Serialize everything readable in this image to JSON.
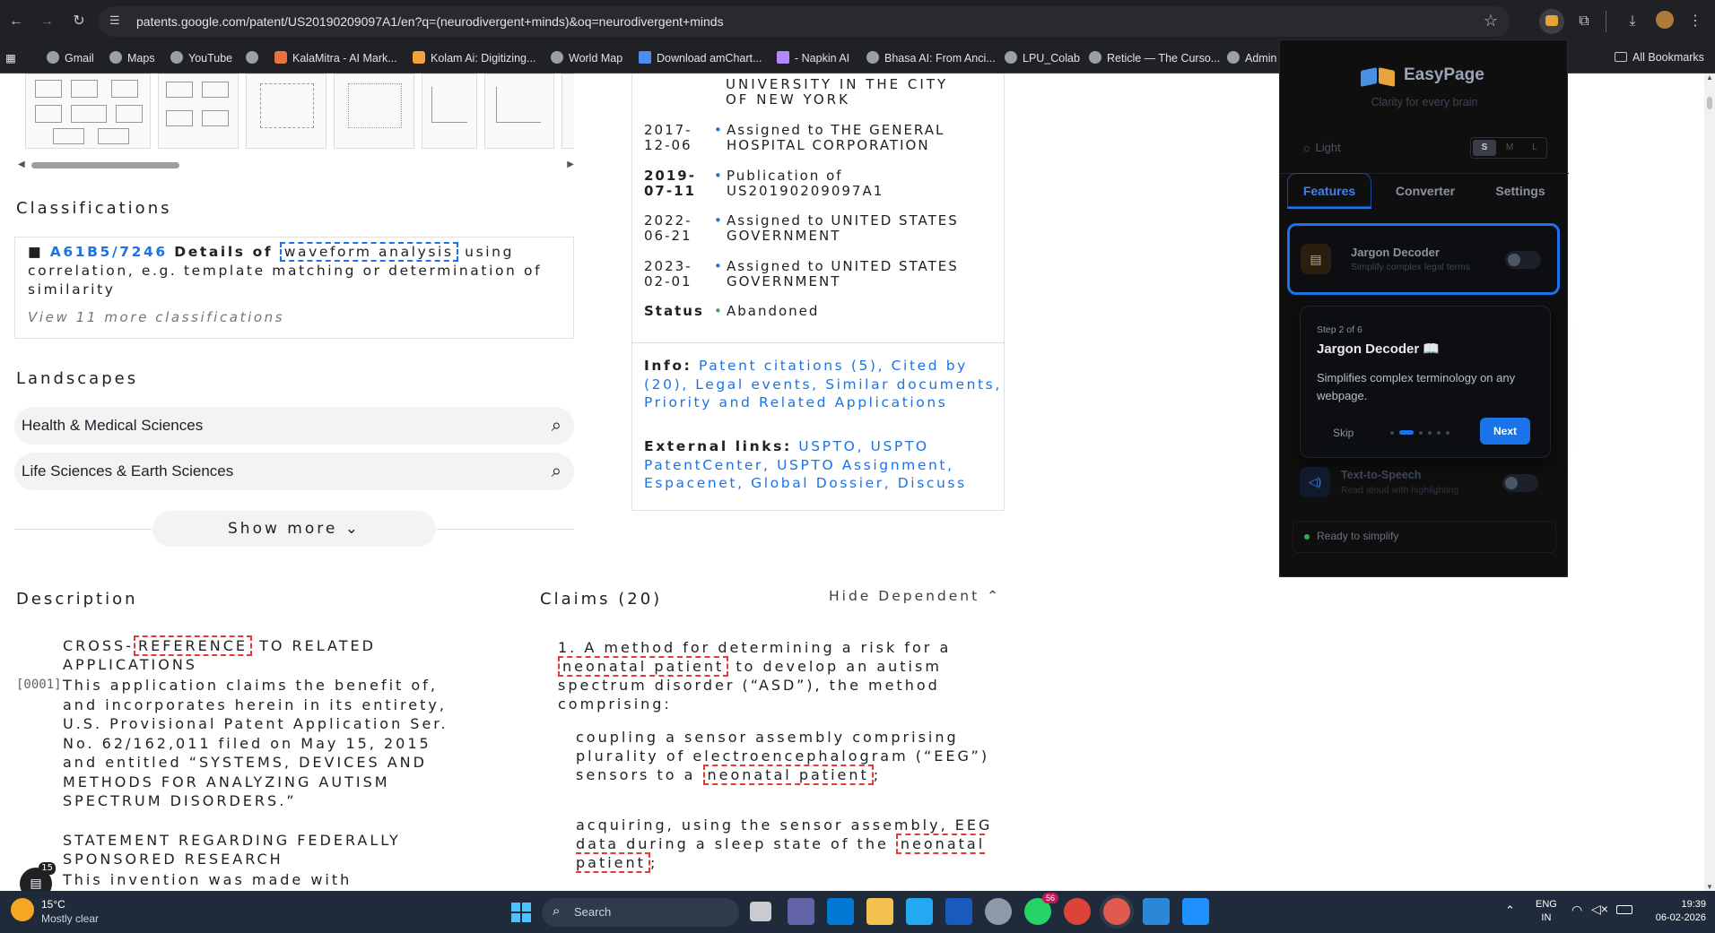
{
  "browser": {
    "url": "patents.google.com/patent/US20190209097A1/en?q=(neurodivergent+minds)&oq=neurodivergent+minds",
    "bookmarks": [
      "Gmail",
      "Maps",
      "YouTube",
      "",
      "KalaMitra - AI Mark...",
      "Kolam Ai: Digitizing...",
      "World Map",
      "Download amChart...",
      "- Napkin AI",
      "Bhasa AI: From Anci...",
      "LPU_Colab",
      "Reticle — The Curso...",
      "Admin"
    ],
    "all_bookmarks": "All Bookmarks"
  },
  "classifications": {
    "heading": "Classifications",
    "code": "A61B5/7246",
    "text_before": "Details of",
    "highlight": "waveform analysis",
    "text_after": "using correlation, e.g. template matching or determination of similarity",
    "more": "View 11 more classifications"
  },
  "landscapes": {
    "heading": "Landscapes",
    "items": [
      "Health & Medical Sciences",
      "Life Sciences & Earth Sciences"
    ],
    "show_more": "Show more"
  },
  "events": {
    "top_text": [
      "UNIVERSITY IN THE CITY",
      "OF NEW YORK"
    ],
    "rows": [
      {
        "date": "2017-12-06",
        "desc": "Assigned to THE GENERAL HOSPITAL CORPORATION"
      },
      {
        "date": "2019-07-11",
        "desc": "Publication of US20190209097A1"
      },
      {
        "date": "2022-06-21",
        "desc": "Assigned to UNITED STATES GOVERNMENT"
      },
      {
        "date": "2023-02-01",
        "desc": "Assigned to UNITED STATES GOVERNMENT"
      }
    ],
    "status_label": "Status",
    "status_value": "Abandoned"
  },
  "info": {
    "label": "Info:",
    "links": "Patent citations (5), Cited by (20), Legal events, Similar documents, Priority and Related Applications",
    "external_label": "External links:",
    "external_links": "USPTO, USPTO PatentCenter, USPTO Assignment, Espacenet, Global Dossier, Discuss"
  },
  "description": {
    "heading": "Description",
    "cross_1": "CROSS-",
    "cross_hl": "REFERENCE",
    "cross_2": "TO RELATED APPLICATIONS",
    "para_num": "[0001]",
    "para": "This application claims the benefit of, and incorporates herein in its entirety, U.S. Provisional Patent Application Ser. No. 62/162,011 filed on May 15, 2015 and entitled “SYSTEMS, DEVICES AND METHODS FOR ANALYZING AUTISM SPECTRUM DISORDERS.”",
    "statement": "STATEMENT REGARDING FEDERALLY SPONSORED RESEARCH",
    "statement_para": "This invention was made with"
  },
  "claims": {
    "heading": "Claims (20)",
    "hide_dependent": "Hide Dependent",
    "c1_a": "1. A method for determining a risk for a",
    "c1_hl": "neonatal patient",
    "c1_b": "to develop an autism spectrum disorder (“ASD”), the method comprising:",
    "c2_a": "coupling a sensor assembly comprising plurality of electroencephalogram (“EEG”) sensors to a",
    "c2_hl": "neonatal patient",
    "c2_b": ";",
    "c3_a": "acquiring, using the sensor assembly, EEG data during a sleep state of the",
    "c3_hl": "neonatal patient",
    "c3_b": ";"
  },
  "extension": {
    "title": "EasyPage",
    "tagline": "Clarity for every brain",
    "theme": "Light",
    "sizes": [
      "S",
      "M",
      "L"
    ],
    "tabs": [
      "Features",
      "Converter",
      "Settings"
    ],
    "feature1_title": "Jargon Decoder",
    "feature1_sub": "Simplify complex legal terms",
    "tour_step": "Step 2 of 6",
    "tour_title": "Jargon Decoder 📖",
    "tour_body": "Simplifies complex terminology on any webpage.",
    "skip": "Skip",
    "next": "Next",
    "feature2_title": "Text-to-Speech",
    "feature2_sub": "Read aloud with highlighting",
    "status": "Ready to simplify"
  },
  "taskbar": {
    "temp": "15°C",
    "weather": "Mostly clear",
    "search": "Search",
    "lang1": "ENG",
    "lang2": "IN",
    "time": "19:39",
    "date": "06-02-2026",
    "chat_badge": "15",
    "whatsapp_badge": "56"
  },
  "colors": {
    "accent": "#1a73e8",
    "highlight_red": "#e53935",
    "ext_blue": "#1a73e8"
  }
}
